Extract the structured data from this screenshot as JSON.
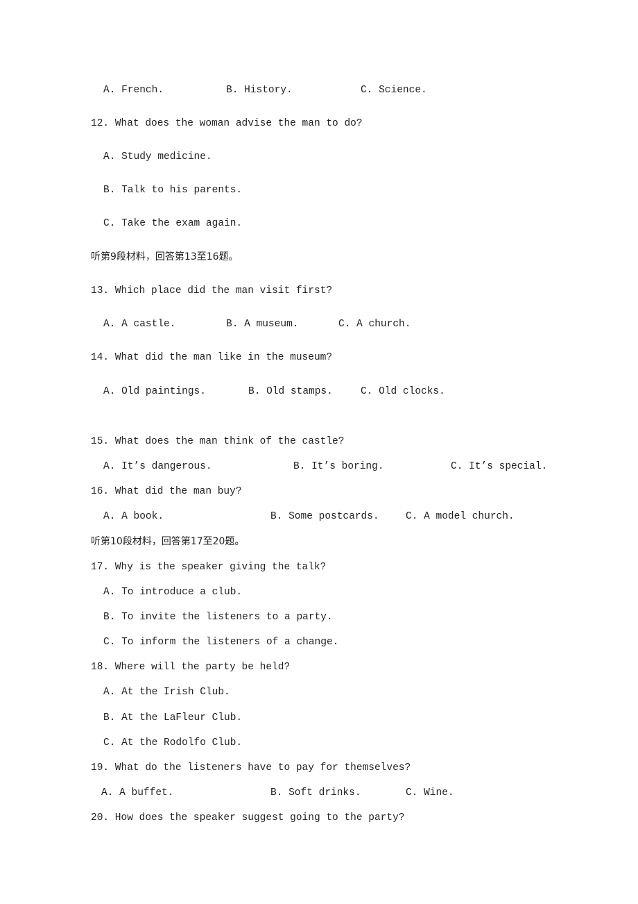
{
  "page": {
    "q11_options": [
      "A. French.",
      "B. History.",
      "C. Science."
    ],
    "q12": {
      "question": "12. What does the woman advise the man to do?",
      "options": [
        "A. Study medicine.",
        "B. Talk to his parents.",
        "C. Take the exam again."
      ]
    },
    "section9": "听第9段材料，回答第13至16题。",
    "q13": {
      "question": "13. Which place did the man visit first?",
      "options": [
        "A. A castle.",
        "B. A museum.",
        "C. A church."
      ]
    },
    "q14": {
      "question": "14. What did the man like in the museum?",
      "options": [
        "A. Old paintings.",
        "B. Old stamps.",
        "C. Old clocks."
      ]
    },
    "q15": {
      "question": "15. What does the man think of the castle?",
      "options": [
        "A. It’s dangerous.",
        "B. It’s boring.",
        "C. It’s special."
      ]
    },
    "q16": {
      "question": "16. What did the man buy?",
      "options": [
        "A. A book.",
        "B. Some postcards.",
        "C. A model church."
      ]
    },
    "section10": "听第10段材料，回答第17至20题。",
    "q17": {
      "question": "17. Why is the speaker giving the talk?",
      "options": [
        "A. To introduce a club.",
        "B. To invite the listeners to a party.",
        "C. To inform the listeners of a change."
      ]
    },
    "q18": {
      "question": "18. Where will the party be held?",
      "options": [
        "A. At the Irish Club.",
        "B. At the LaFleur Club.",
        "C. At the Rodolfo Club."
      ]
    },
    "q19": {
      "question": "19. What do the listeners have to pay for themselves?",
      "options": [
        "A. A buffet.",
        "B. Soft drinks.",
        "C. Wine."
      ]
    },
    "q20": {
      "question": "20. How does the speaker suggest going to the party?"
    }
  }
}
